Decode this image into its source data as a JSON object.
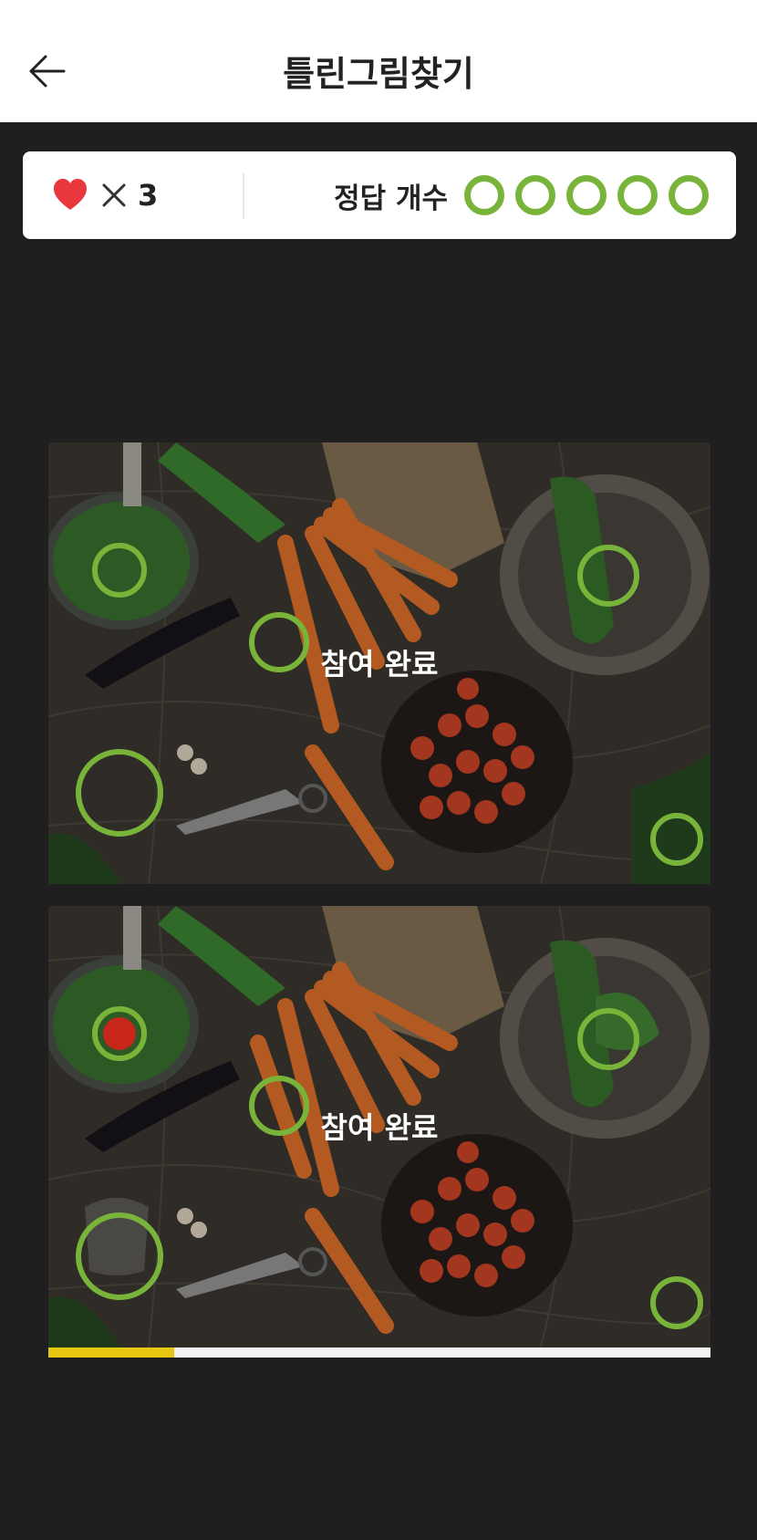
{
  "header": {
    "title": "틀린그림찾기",
    "back_icon": "arrow-left-icon"
  },
  "status": {
    "lives_icon": "heart-icon",
    "lives_multiplier_icon": "times-icon",
    "lives_count": "3",
    "answers_label": "정답 개수",
    "answers_total": 5,
    "answers_found": 5,
    "accent_color": "#79b43a"
  },
  "images": {
    "top_overlay_text": "참여 완료",
    "bottom_overlay_text": "참여 완료"
  },
  "progress": {
    "fraction": 0.19,
    "fill_color": "#e8c712"
  }
}
